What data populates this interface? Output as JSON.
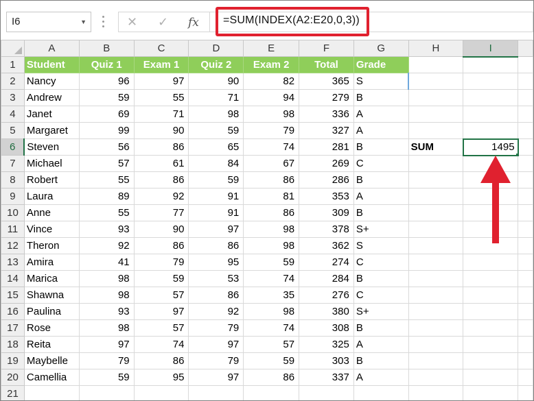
{
  "formula_bar": {
    "name_box": "I6",
    "cancel_icon": "✕",
    "enter_icon": "✓",
    "fx_label": "fx",
    "formula": "=SUM(INDEX(A2:E20,0,3))"
  },
  "columns": [
    "A",
    "B",
    "C",
    "D",
    "E",
    "F",
    "G",
    "H",
    "I"
  ],
  "headers": [
    "Student",
    "Quiz 1",
    "Exam 1",
    "Quiz 2",
    "Exam 2",
    "Total",
    "Grade"
  ],
  "rows": [
    [
      "Nancy",
      "96",
      "97",
      "90",
      "82",
      "365",
      "S"
    ],
    [
      "Andrew",
      "59",
      "55",
      "71",
      "94",
      "279",
      "B"
    ],
    [
      "Janet",
      "69",
      "71",
      "98",
      "98",
      "336",
      "A"
    ],
    [
      "Margaret",
      "99",
      "90",
      "59",
      "79",
      "327",
      "A"
    ],
    [
      "Steven",
      "56",
      "86",
      "65",
      "74",
      "281",
      "B"
    ],
    [
      "Michael",
      "57",
      "61",
      "84",
      "67",
      "269",
      "C"
    ],
    [
      "Robert",
      "55",
      "86",
      "59",
      "86",
      "286",
      "B"
    ],
    [
      "Laura",
      "89",
      "92",
      "91",
      "81",
      "353",
      "A"
    ],
    [
      "Anne",
      "55",
      "77",
      "91",
      "86",
      "309",
      "B"
    ],
    [
      "Vince",
      "93",
      "90",
      "97",
      "98",
      "378",
      "S+"
    ],
    [
      "Theron",
      "92",
      "86",
      "86",
      "98",
      "362",
      "S"
    ],
    [
      "Amira",
      "41",
      "79",
      "95",
      "59",
      "274",
      "C"
    ],
    [
      "Marica",
      "98",
      "59",
      "53",
      "74",
      "284",
      "B"
    ],
    [
      "Shawna",
      "98",
      "57",
      "86",
      "35",
      "276",
      "C"
    ],
    [
      "Paulina",
      "93",
      "97",
      "92",
      "98",
      "380",
      "S+"
    ],
    [
      "Rose",
      "98",
      "57",
      "79",
      "74",
      "308",
      "B"
    ],
    [
      "Reita",
      "97",
      "74",
      "97",
      "57",
      "325",
      "A"
    ],
    [
      "Maybelle",
      "79",
      "86",
      "79",
      "59",
      "303",
      "B"
    ],
    [
      "Camellia",
      "59",
      "95",
      "97",
      "86",
      "337",
      "A"
    ]
  ],
  "row_numbers": [
    "1",
    "2",
    "3",
    "4",
    "5",
    "6",
    "7",
    "8",
    "9",
    "10",
    "11",
    "12",
    "13",
    "14",
    "15",
    "16",
    "17",
    "18",
    "19",
    "20",
    "21"
  ],
  "sum_label": "SUM",
  "sum_value": "1495",
  "colors": {
    "header_fill": "#8fce5a",
    "highlight_red": "#e0212f",
    "selection_green": "#217346"
  }
}
